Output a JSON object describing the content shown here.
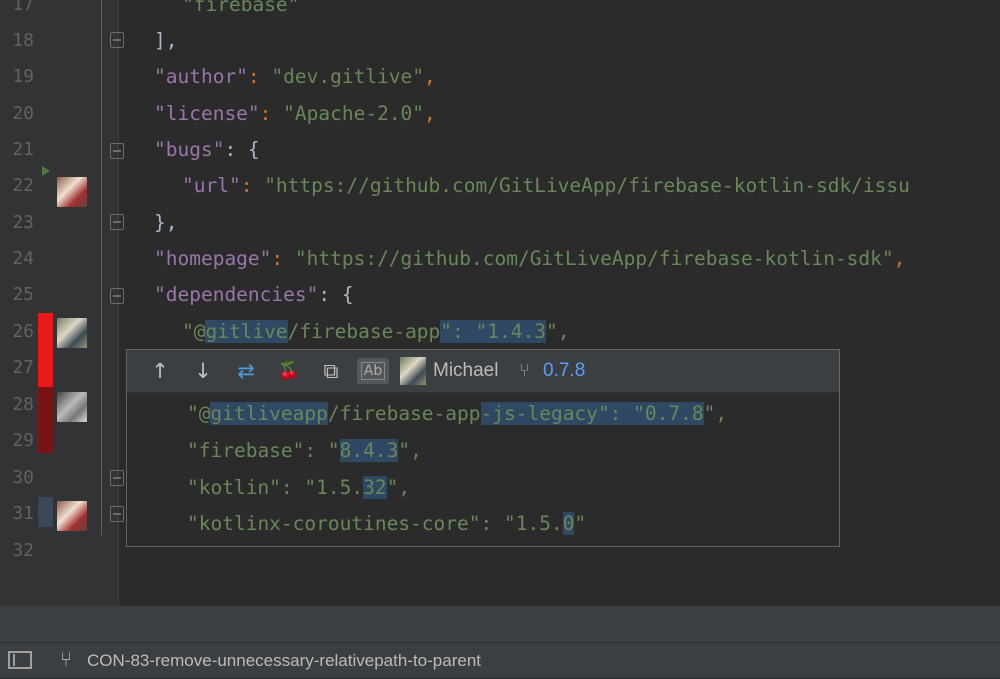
{
  "editor": {
    "line_numbers": [
      "17",
      "18",
      "19",
      "20",
      "21",
      "22",
      "23",
      "24",
      "25",
      "26",
      "27",
      "28",
      "29",
      "30",
      "31",
      "32"
    ],
    "lines": {
      "l17": "\"firebase\"",
      "l18": "],",
      "l19_key": "\"author\"",
      "l19_val": "\"dev.gitlive\"",
      "l20_key": "\"license\"",
      "l20_val": "\"Apache-2.0\"",
      "l21_key": "\"bugs\"",
      "l21_rest": ": {",
      "l22_key": "\"url\"",
      "l22_val": "\"https://github.com/GitLiveApp/firebase-kotlin-sdk/issu",
      "l23": "},",
      "l24_key": "\"homepage\"",
      "l24_val": "\"https://github.com/GitLiveApp/firebase-kotlin-sdk\"",
      "l25_key": "\"dependencies\"",
      "l25_rest": ": {",
      "l26_a": "\"@",
      "l26_b": "gitlive",
      "l26_c": "/firebase-app",
      "l26_d": "\": \"1.4.3",
      "l26_e": "\","
    }
  },
  "popup": {
    "toolbar": {
      "up_icon": "↑",
      "down_icon": "↓",
      "compare_icon": "⇄",
      "cherry_icon": "🍒",
      "copy_icon": "⧉",
      "ab_label": "Ab",
      "author": "Michael",
      "branch_icon": "⑂",
      "version": "0.7.8"
    },
    "lines": {
      "p1_a": "\"@",
      "p1_b": "gitliveapp",
      "p1_c": "/firebase-app",
      "p1_d": "-js-legacy\": \"0.7.8",
      "p1_e": "\",",
      "p2_a": "\"firebase\": \"",
      "p2_b": "8.4.3",
      "p2_c": "\",",
      "p3_a": "\"kotlin\": \"1.5.",
      "p3_b": "32",
      "p3_c": "\",",
      "p4_a": "\"kotlinx-coroutines-core\": \"1.5.",
      "p4_b": "0",
      "p4_c": "\""
    }
  },
  "statusbar": {
    "branch_icon": "⑂",
    "branch": "CON-83-remove-unnecessary-relativepath-to-parent"
  }
}
